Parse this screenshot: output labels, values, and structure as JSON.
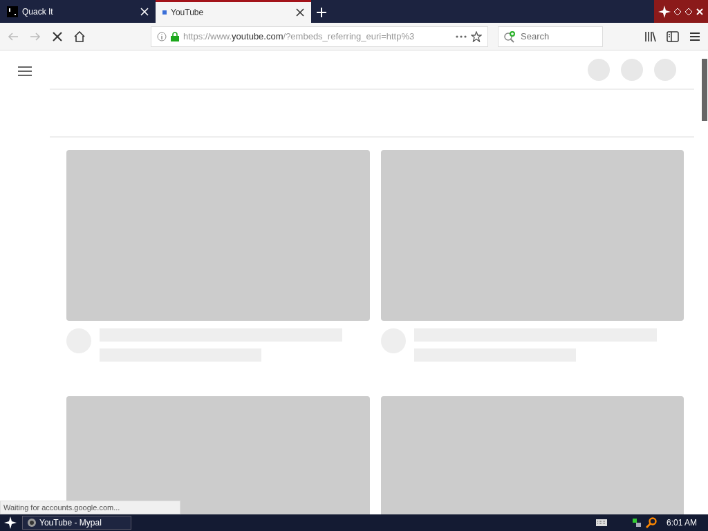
{
  "tabs": [
    {
      "title": "Quack It",
      "selected": false
    },
    {
      "title": "YouTube",
      "selected": true
    }
  ],
  "toolbar": {
    "loading": true,
    "url": {
      "scheme": "https://www.",
      "domain": "youtube.com",
      "rest": "/?embeds_referring_euri=http%3"
    },
    "search": {
      "placeholder": "Search"
    }
  },
  "status_text": "Waiting for accounts.google.com...",
  "taskbar": {
    "windows": [
      {
        "title": "YouTube - Mypal",
        "selected": false
      }
    ],
    "clock": "6:01 AM"
  }
}
